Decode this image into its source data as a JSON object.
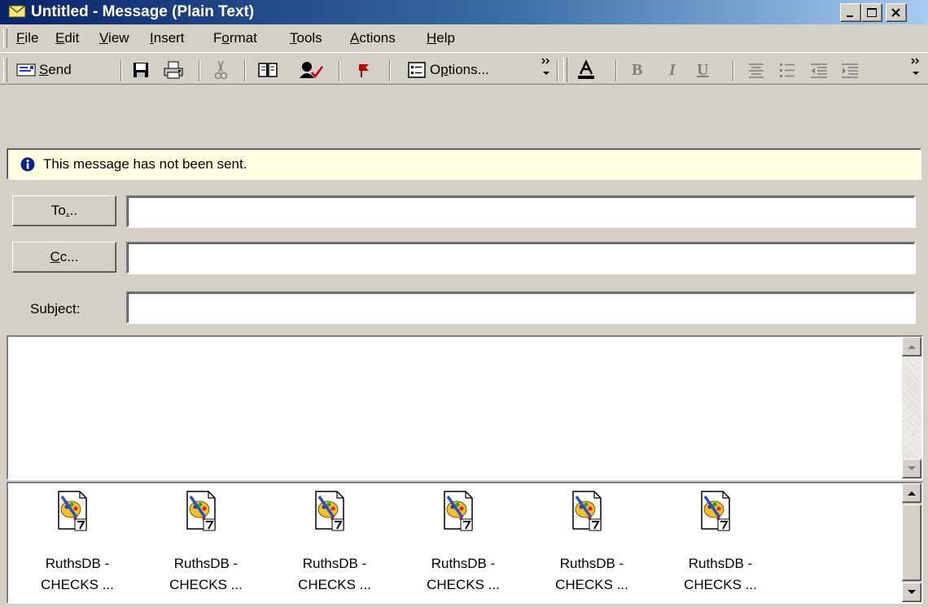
{
  "window": {
    "title": "Untitled - Message (Plain Text)",
    "caption_buttons": [
      "minimize-icon",
      "maximize-icon",
      "close-icon"
    ]
  },
  "menu": {
    "items": [
      {
        "pre": "",
        "key": "F",
        "post": "ile"
      },
      {
        "pre": "",
        "key": "E",
        "post": "dit"
      },
      {
        "pre": "",
        "key": "V",
        "post": "iew"
      },
      {
        "pre": "",
        "key": "I",
        "post": "nsert"
      },
      {
        "pre": "F",
        "key": "o",
        "post": "rmat"
      },
      {
        "pre": "",
        "key": "T",
        "post": "ools"
      },
      {
        "pre": "",
        "key": "A",
        "post": "ctions"
      },
      {
        "pre": "",
        "key": "H",
        "post": "elp"
      }
    ]
  },
  "toolbar": {
    "send_pre": "",
    "send_key": "S",
    "send_post": "end",
    "options_pre": "O",
    "options_key": "p",
    "options_post": "tions...",
    "icons": [
      "send-icon",
      "save-icon",
      "print-icon",
      "cut-icon",
      "address-book-icon",
      "check-names-icon",
      "flag-icon",
      "options-icon",
      "font-color-icon",
      "bold-icon",
      "italic-icon",
      "underline-icon",
      "align-center-icon",
      "bullets-icon",
      "decrease-indent-icon",
      "increase-indent-icon",
      "more-chevron-icon"
    ],
    "bold_glyph": "B",
    "italic_glyph": "I",
    "underline_glyph": "U"
  },
  "info_bar": {
    "text": "This message has not been sent."
  },
  "header_fields": {
    "to_pre": "To",
    "to_key": ".",
    "to_post": "..",
    "cc_pre": "",
    "cc_key": "C",
    "cc_post": "c...",
    "subject_pre": "Sub",
    "subject_key": "j",
    "subject_post": "ect:",
    "to_value": "",
    "cc_value": "",
    "subject_value": ""
  },
  "body": {
    "text": ""
  },
  "attachments": [
    {
      "line1": "RuthsDB -",
      "line2": "CHECKS ..."
    },
    {
      "line1": "RuthsDB -",
      "line2": "CHECKS ..."
    },
    {
      "line1": "RuthsDB -",
      "line2": "CHECKS ..."
    },
    {
      "line1": "RuthsDB -",
      "line2": "CHECKS ..."
    },
    {
      "line1": "RuthsDB -",
      "line2": "CHECKS ..."
    },
    {
      "line1": "RuthsDB -",
      "line2": "CHECKS ..."
    }
  ],
  "colors": {
    "titlebar_start": "#0a246a",
    "titlebar_end": "#a6caf0",
    "chrome": "#d4d0c8",
    "info_bg": "#ffffe1"
  }
}
